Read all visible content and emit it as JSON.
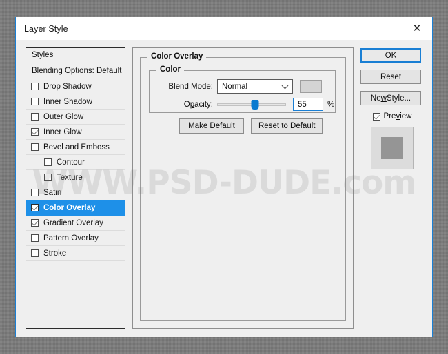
{
  "window": {
    "title": "Layer Style",
    "close_icon": "close-icon"
  },
  "watermark": "WWW.PSD-DUDE.com",
  "styles_panel": {
    "header_styles": "Styles",
    "header_blending": "Blending Options: Default",
    "effects": [
      {
        "label": "Drop Shadow",
        "checked": false,
        "indent": false,
        "selected": false
      },
      {
        "label": "Inner Shadow",
        "checked": false,
        "indent": false,
        "selected": false
      },
      {
        "label": "Outer Glow",
        "checked": false,
        "indent": false,
        "selected": false
      },
      {
        "label": "Inner Glow",
        "checked": true,
        "indent": false,
        "selected": false
      },
      {
        "label": "Bevel and Emboss",
        "checked": false,
        "indent": false,
        "selected": false
      },
      {
        "label": "Contour",
        "checked": false,
        "indent": true,
        "selected": false
      },
      {
        "label": "Texture",
        "checked": false,
        "indent": true,
        "selected": false
      },
      {
        "label": "Satin",
        "checked": false,
        "indent": false,
        "selected": false
      },
      {
        "label": "Color Overlay",
        "checked": true,
        "indent": false,
        "selected": true
      },
      {
        "label": "Gradient Overlay",
        "checked": true,
        "indent": false,
        "selected": false
      },
      {
        "label": "Pattern Overlay",
        "checked": false,
        "indent": false,
        "selected": false
      },
      {
        "label": "Stroke",
        "checked": false,
        "indent": false,
        "selected": false
      }
    ]
  },
  "main_panel": {
    "group_title": "Color Overlay",
    "color_group_title": "Color",
    "blend_mode": {
      "label": "Blend Mode:",
      "value": "Normal",
      "caret_icon": "chevron-down-icon",
      "swatch_color": "#d4d4d4"
    },
    "opacity": {
      "label": "Opacity:",
      "value": "55",
      "unit": "%",
      "percent": 55
    },
    "make_default_label": "Make Default",
    "reset_to_default_label": "Reset to Default"
  },
  "side_buttons": {
    "ok": "OK",
    "reset": "Reset",
    "new_style": "New Style...",
    "preview_label": "Preview",
    "preview_checked": true
  },
  "colors": {
    "accent": "#1e90e8",
    "dialog_border": "#1a7fd4",
    "slider_thumb": "#0a7ad0",
    "desktop": "#7b7b7b"
  }
}
